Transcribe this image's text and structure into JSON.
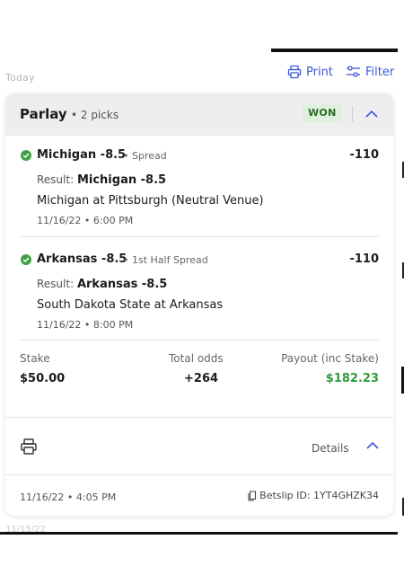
{
  "toolbar": {
    "section_label": "Today",
    "print_label": "Print",
    "filter_label": "Filter"
  },
  "colors": {
    "accent": "#3a56d6",
    "won_bg": "#dff1de",
    "won_text": "#2c6b25",
    "payout_green": "#2e9c3a",
    "check_green": "#43a047"
  },
  "bet": {
    "title": "Parlay",
    "subtitle": "• 2 picks",
    "status": "WON",
    "picks": [
      {
        "name": "Michigan -8.5",
        "type": "• Spread",
        "odds": "-110",
        "result_label": "Result:",
        "result_value": "Michigan -8.5",
        "matchup": "Michigan at Pittsburgh (Neutral Venue)",
        "datetime": "11/16/22 • 6:00 PM"
      },
      {
        "name": "Arkansas -8.5",
        "type": "• 1st Half Spread",
        "odds": "-110",
        "result_label": "Result:",
        "result_value": "Arkansas -8.5",
        "matchup": "South Dakota State at Arkansas",
        "datetime": "11/16/22 • 8:00 PM"
      }
    ],
    "summary": {
      "stake_label": "Stake",
      "stake_value": "$50.00",
      "odds_label": "Total odds",
      "odds_value": "+264",
      "payout_label": "Payout (inc Stake)",
      "payout_value": "$182.23"
    },
    "footer": {
      "details_label": "Details",
      "placed_datetime": "11/16/22 • 4:05 PM",
      "betslip_label": "Betslip ID: 1YT4GHZK34"
    }
  },
  "next_section_label": "11/15/22"
}
